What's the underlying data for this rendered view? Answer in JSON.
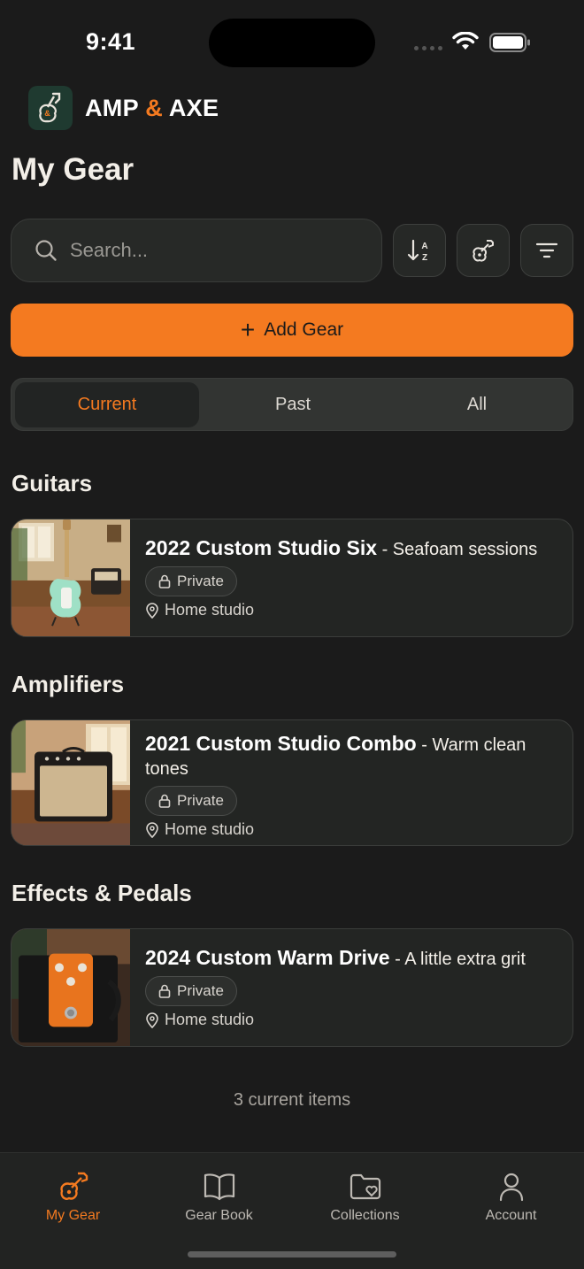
{
  "status": {
    "time": "9:41"
  },
  "brand": {
    "name_part1": "AMP ",
    "name_amp": "&",
    "name_part2": " AXE"
  },
  "page": {
    "title": "My Gear"
  },
  "search": {
    "placeholder": "Search..."
  },
  "add_button": {
    "label": "Add Gear"
  },
  "tabs_filter": [
    {
      "label": "Current",
      "active": true
    },
    {
      "label": "Past",
      "active": false
    },
    {
      "label": "All",
      "active": false
    }
  ],
  "sections": [
    {
      "title": "Guitars",
      "items": [
        {
          "name": "2022 Custom Studio Six",
          "separator": " - ",
          "subtitle": "Seafoam sessions",
          "visibility": "Private",
          "location": "Home studio",
          "icon": "guitar-photo"
        }
      ]
    },
    {
      "title": "Amplifiers",
      "items": [
        {
          "name": "2021 Custom Studio Combo",
          "separator": " - ",
          "subtitle": "Warm clean tones",
          "visibility": "Private",
          "location": "Home studio",
          "icon": "amp-photo"
        }
      ]
    },
    {
      "title": "Effects & Pedals",
      "items": [
        {
          "name": "2024 Custom Warm Drive",
          "separator": " - ",
          "subtitle": "A little extra grit",
          "visibility": "Private",
          "location": "Home studio",
          "icon": "pedal-photo"
        }
      ]
    }
  ],
  "footer": {
    "count_text": "3 current items"
  },
  "tabbar": [
    {
      "label": "My Gear",
      "icon": "guitar-icon",
      "active": true
    },
    {
      "label": "Gear Book",
      "icon": "book-icon",
      "active": false
    },
    {
      "label": "Collections",
      "icon": "folder-heart-icon",
      "active": false
    },
    {
      "label": "Account",
      "icon": "person-icon",
      "active": false
    }
  ],
  "colors": {
    "accent": "#f47a20",
    "background": "#1b1b1b",
    "card": "#232523"
  }
}
